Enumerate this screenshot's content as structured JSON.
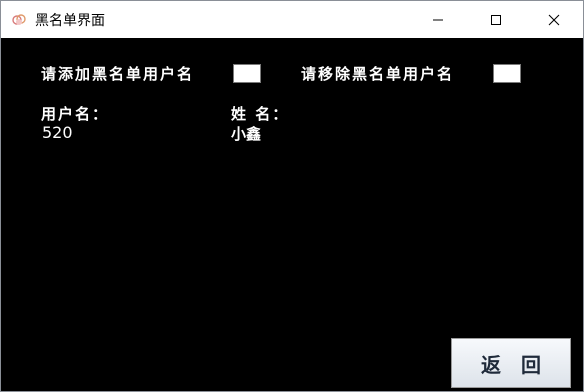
{
  "window": {
    "title": "黑名单界面",
    "icon": "app-icon",
    "controls": [
      "minimize-icon",
      "maximize-icon",
      "close-icon"
    ]
  },
  "form": {
    "add_label": "请添加黑名单用户名",
    "add_value": "",
    "remove_label": "请移除黑名单用户名",
    "remove_value": ""
  },
  "list": {
    "username_header": "用户名：",
    "name_header": "姓 名：",
    "rows": [
      {
        "username": "520",
        "name": "小鑫"
      }
    ]
  },
  "buttons": {
    "return_label": "返回"
  }
}
